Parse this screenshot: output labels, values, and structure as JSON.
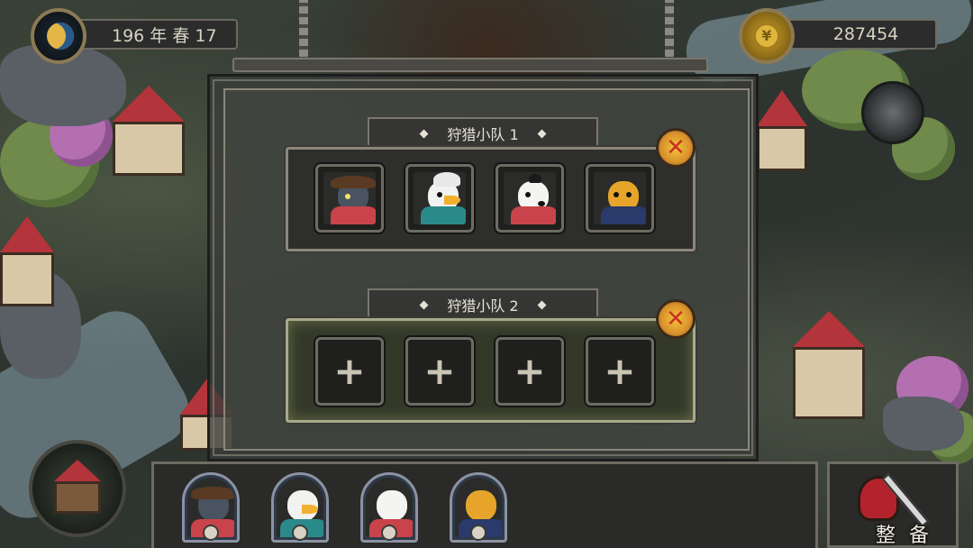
{
  "hud": {
    "date_text": "196 年 春 17",
    "coins_text": "287454"
  },
  "squads": [
    {
      "title": "狩猎小队 1",
      "state": "filled",
      "members": [
        {
          "icon": "buffalo-pirate-portrait-icon",
          "head": "#4a5360",
          "body": "#c9434a",
          "hat": "#5a3a22"
        },
        {
          "icon": "eagle-portrait-icon",
          "head": "#f2f2f0",
          "body": "#2a8a8a",
          "hat": "#e8e8e8"
        },
        {
          "icon": "polar-bear-portrait-icon",
          "head": "#f4f4f2",
          "body": "#c9434a",
          "hat": "#1a1a1a"
        },
        {
          "icon": "leopard-portrait-icon",
          "head": "#e6a52a",
          "body": "#2a3a6a",
          "hat": "#2a3a6a"
        }
      ]
    },
    {
      "title": "狩猎小队 2",
      "state": "empty",
      "slots": 4
    }
  ],
  "roster": [
    {
      "icon": "buffalo-pirate-portrait-icon",
      "role_icon": "shield-icon"
    },
    {
      "icon": "eagle-portrait-icon",
      "role_icon": "claw-icon"
    },
    {
      "icon": "polar-bear-portrait-icon",
      "role_icon": "lightning-icon"
    },
    {
      "icon": "leopard-portrait-icon",
      "role_icon": "heart-icon"
    }
  ],
  "equip_button": {
    "label": "整 备"
  },
  "colors": {
    "close_button": "#f2c53a",
    "close_x": "#c9331f",
    "active_glow": "#a7a98a"
  }
}
